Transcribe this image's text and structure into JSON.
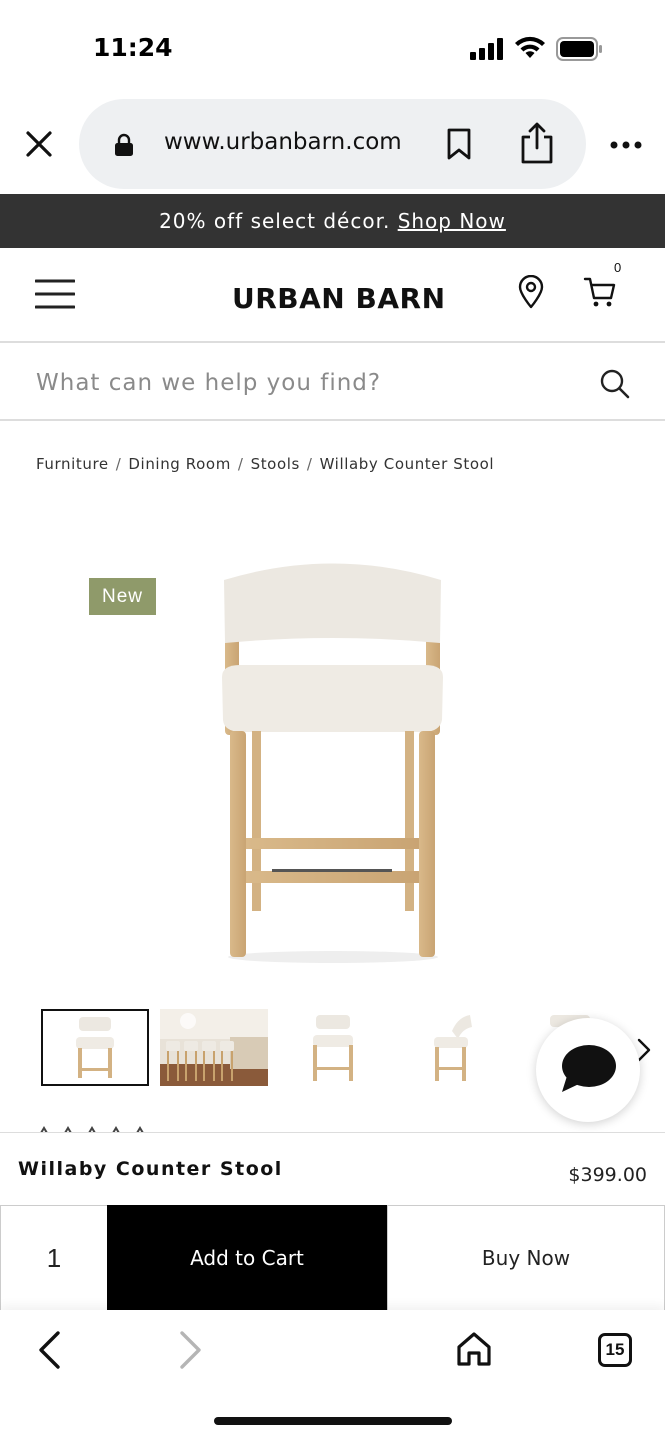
{
  "status_bar": {
    "time": "11:24"
  },
  "browser": {
    "url": "www.urbanbarn.com",
    "tab_count": "15"
  },
  "promo": {
    "text": "20% off select décor.",
    "link": "Shop Now"
  },
  "header": {
    "logo": "URBAN BARN",
    "cart_count": "0"
  },
  "search": {
    "placeholder": "What can we help you find?"
  },
  "breadcrumb": [
    "Furniture",
    "Dining Room",
    "Stools",
    "Willaby Counter Stool"
  ],
  "product": {
    "badge": "New",
    "name": "Willaby Counter Stool",
    "price": "$399.00",
    "quantity": "1",
    "add_to_cart_label": "Add to Cart",
    "buy_now_label": "Buy Now"
  },
  "colors": {
    "promo_bg": "#333333",
    "badge_bg": "#8f9a6a",
    "cart_button_bg": "#000000"
  }
}
